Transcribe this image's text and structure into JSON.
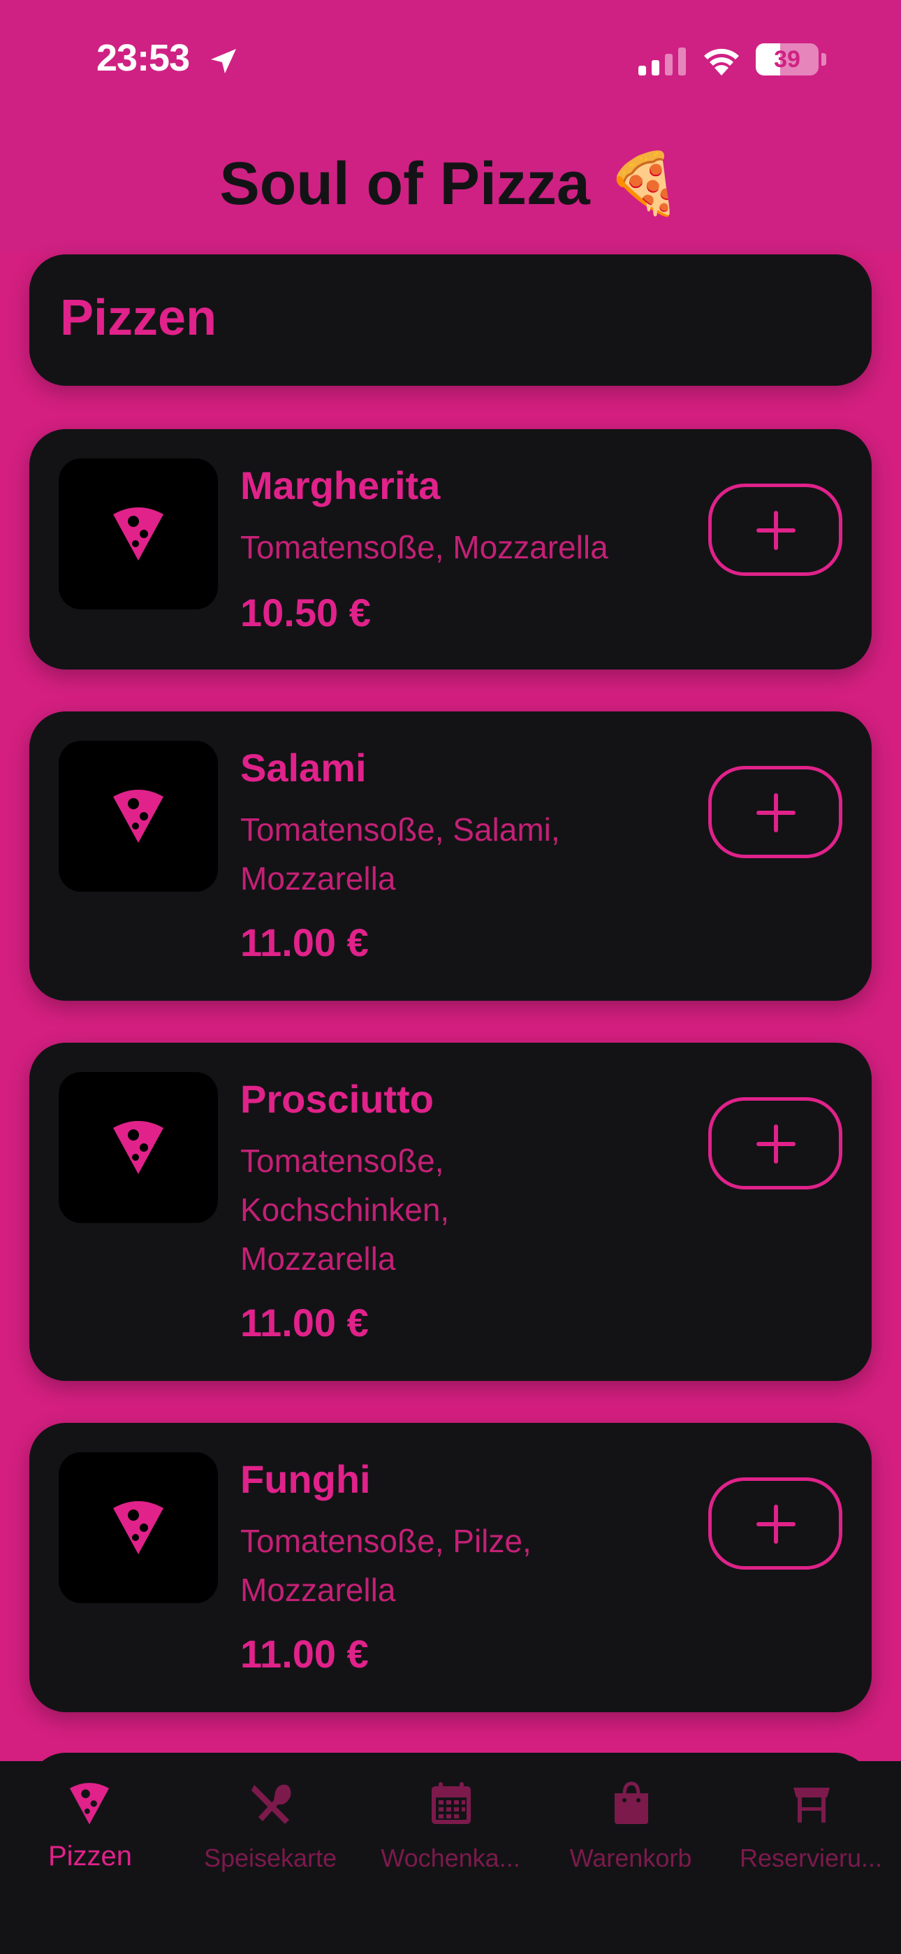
{
  "status_bar": {
    "time": "23:53",
    "battery": "39"
  },
  "header": {
    "title": "Soul of Pizza 🍕"
  },
  "section": {
    "title": "Pizzen"
  },
  "items": [
    {
      "name": "Margherita",
      "description": "Tomatensoße, Mozzarella",
      "price": "10.50 €"
    },
    {
      "name": "Salami",
      "description": "Tomatensoße, Salami, Mozzarella",
      "price": "11.00 €"
    },
    {
      "name": "Prosciutto",
      "description": "Tomatensoße, Kochschinken, Mozzarella",
      "price": "11.00 €"
    },
    {
      "name": "Funghi",
      "description": "Tomatensoße, Pilze, Mozzarella",
      "price": "11.00 €"
    }
  ],
  "tabs": [
    {
      "label": "Pizzen",
      "icon": "pizza-slice-icon",
      "active": true
    },
    {
      "label": "Speisekarte",
      "icon": "fork-knife-icon",
      "active": false
    },
    {
      "label": "Wochenka...",
      "icon": "calendar-icon",
      "active": false
    },
    {
      "label": "Warenkorb",
      "icon": "shopping-bag-icon",
      "active": false
    },
    {
      "label": "Reservieru...",
      "icon": "table-icon",
      "active": false
    }
  ],
  "colors": {
    "background": "#d41f80",
    "card": "#131316",
    "accent": "#e0228a",
    "tab_inactive": "#7c1a4c"
  }
}
